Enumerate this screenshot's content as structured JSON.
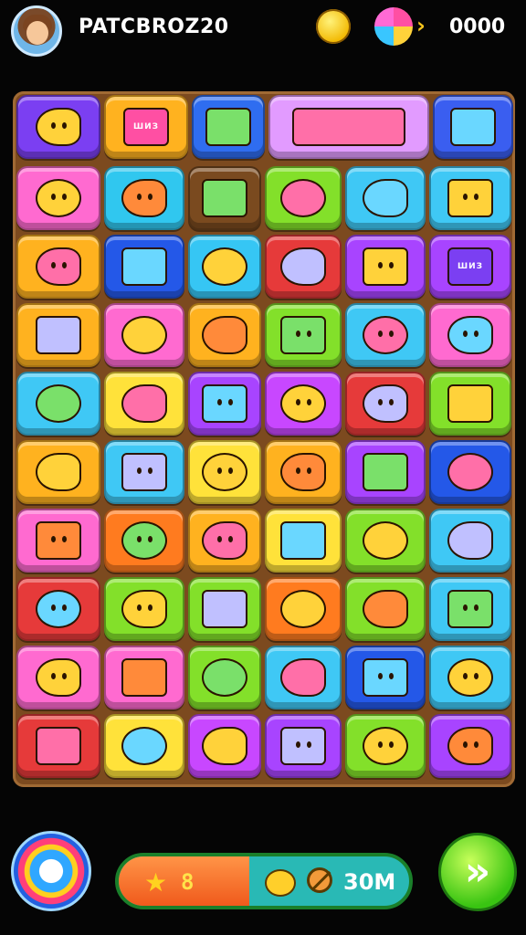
{
  "header": {
    "username": "PATCBRОZ20",
    "score": "0000"
  },
  "board": {
    "top_row": [
      {
        "color": "#7b3ff2",
        "icon": "smiley-fish-icon",
        "text": ""
      },
      {
        "color": "#ffb21f",
        "icon": "ticket-icon",
        "text": "ШИЗ"
      },
      {
        "color": "#2f6df0",
        "icon": "bottle-icon",
        "text": ""
      },
      {
        "color": "#e29bff",
        "icon": "box-and-rocket-icon",
        "text": ""
      },
      {
        "color": "#3a5ef0",
        "icon": "fish-icon",
        "text": ""
      }
    ],
    "rows": [
      [
        "#ff6ad0",
        "#30c7ef",
        "#7a4a1f",
        "#83e02a",
        "#3fc8f5",
        "#3fc8f5"
      ],
      [
        "#ffb21f",
        "#2458e8",
        "#36c6f4",
        "#e63a3a",
        "#a844ff",
        "#a844ff"
      ],
      [
        "#ffb21f",
        "#ff6ad0",
        "#ffb21f",
        "#83e02a",
        "#3fc8f5",
        "#ff6ad0"
      ],
      [
        "#3fc8f5",
        "#ffe23a",
        "#a844ff",
        "#c847ff",
        "#e63a3a",
        "#83e02a"
      ],
      [
        "#ffb21f",
        "#3fc8f5",
        "#ffe23a",
        "#ffb21f",
        "#a844ff",
        "#2458e8"
      ],
      [
        "#ff6ad0",
        "#ff7b1f",
        "#ffb21f",
        "#ffe23a",
        "#83e02a",
        "#3fc8f5"
      ],
      [
        "#e63a3a",
        "#83e02a",
        "#83e02a",
        "#ff7b1f",
        "#83e02a",
        "#3fc8f5"
      ],
      [
        "#ff6ad0",
        "#ff6ad0",
        "#83e02a",
        "#3fc8f5",
        "#2458e8",
        "#3fc8f5"
      ],
      [
        "#e63a3a",
        "#ffe23a",
        "#c847ff",
        "#a844ff",
        "#83e02a",
        "#a844ff"
      ]
    ],
    "row_icons": [
      [
        "ship-icon",
        "fish-icon",
        "sun-face-icon",
        "fish-icon",
        "fish-icon",
        "fish-icon"
      ],
      [
        "submarine-icon",
        "fruit-icon",
        "paint-tube-icon",
        "gem-icon",
        "cup-icon",
        "sign-icon"
      ],
      [
        "map-icon",
        "onion-icon",
        "sausage-icon",
        "house-icon",
        "two-faces-icon",
        "fish-icon"
      ],
      [
        "fish-icon",
        "onion-icon",
        "plant-icon",
        "vegetables-icon",
        "machine-icon",
        "flags-icon"
      ],
      [
        "shell-icon",
        "fruit-icon",
        "phone-icon",
        "pot-icon",
        "cucumber-icon",
        "turtle-icon"
      ],
      [
        "arrow-icon",
        "card-icon",
        "basket-icon",
        "fish-icon",
        "card-icon",
        "roll-icon"
      ],
      [
        "rocket-icon",
        "fish-icon",
        "radio-icon",
        "bag-icon",
        "gadget-icon",
        "face-icon"
      ],
      [
        "fish-icon",
        "face-icon",
        "root-icon",
        "palm-icon",
        "fish-icon",
        "book-icon"
      ],
      [
        "fish-icon",
        "flag-icon",
        "sun-icon",
        "fish-icon",
        "camera-icon",
        "palm-icon"
      ]
    ],
    "sign_text": "ШИЗ"
  },
  "bottom": {
    "progress_left_text": "8",
    "progress_right_text": "30M",
    "progress_fraction": 0.45,
    "life_icon": "globe-icon",
    "next_icon": "fast-forward-icon",
    "next_glyph": "»"
  }
}
